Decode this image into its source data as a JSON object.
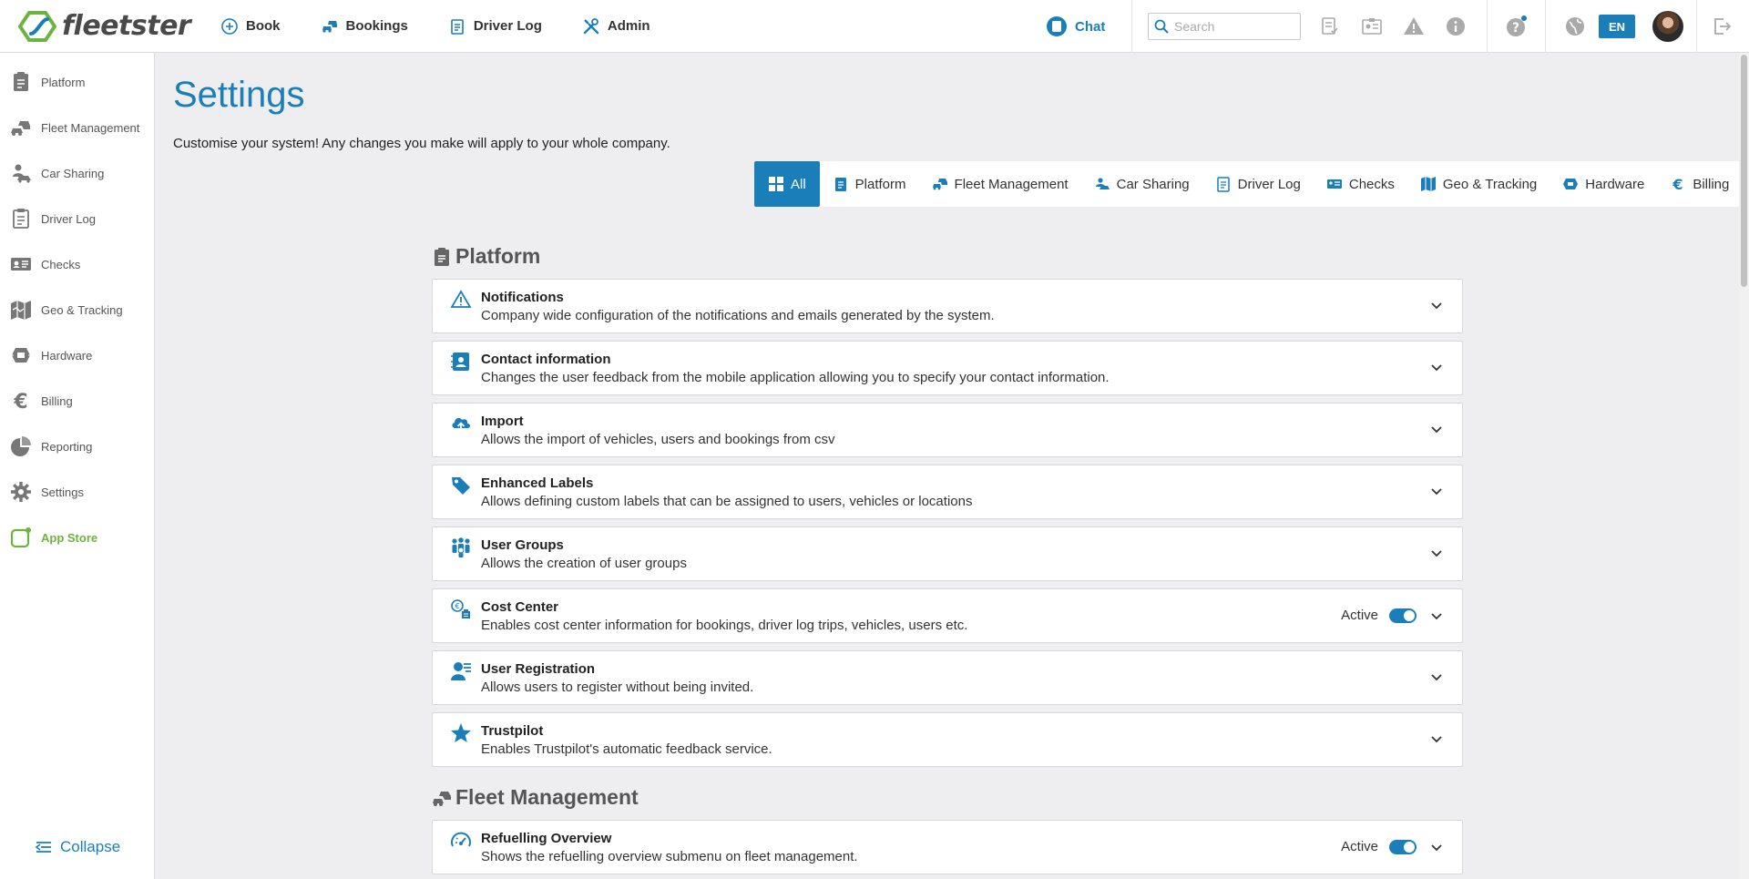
{
  "brand": {
    "name": "fleetster"
  },
  "topnav": [
    {
      "label": "Book",
      "icon": "plus-circle-icon"
    },
    {
      "label": "Bookings",
      "icon": "cars-icon"
    },
    {
      "label": "Driver Log",
      "icon": "clipboard-icon"
    },
    {
      "label": "Admin",
      "icon": "tools-icon"
    }
  ],
  "topbar": {
    "chat_label": "Chat",
    "search_placeholder": "Search",
    "lang": "EN"
  },
  "sidebar": {
    "items": [
      {
        "label": "Platform",
        "icon": "clipboard-icon"
      },
      {
        "label": "Fleet Management",
        "icon": "cars-icon"
      },
      {
        "label": "Car Sharing",
        "icon": "car-sharing-icon"
      },
      {
        "label": "Driver Log",
        "icon": "driver-log-icon"
      },
      {
        "label": "Checks",
        "icon": "id-card-icon"
      },
      {
        "label": "Geo & Tracking",
        "icon": "map-icon"
      },
      {
        "label": "Hardware",
        "icon": "hardware-icon"
      },
      {
        "label": "Billing",
        "icon": "euro-icon"
      },
      {
        "label": "Reporting",
        "icon": "pie-chart-icon"
      },
      {
        "label": "Settings",
        "icon": "gear-icon"
      },
      {
        "label": "App Store",
        "icon": "app-store-icon"
      }
    ],
    "collapse_label": "Collapse"
  },
  "page": {
    "title": "Settings",
    "description": "Customise your system! Any changes you make will apply to your whole company."
  },
  "filters": [
    {
      "label": "All",
      "active": true
    },
    {
      "label": "Platform"
    },
    {
      "label": "Fleet Management"
    },
    {
      "label": "Car Sharing"
    },
    {
      "label": "Driver Log"
    },
    {
      "label": "Checks"
    },
    {
      "label": "Geo & Tracking"
    },
    {
      "label": "Hardware"
    },
    {
      "label": "Billing"
    }
  ],
  "sections": {
    "platform": {
      "title": "Platform",
      "cards": [
        {
          "title": "Notifications",
          "desc": "Company wide configuration of the notifications and emails generated by the system.",
          "icon": "warning-icon"
        },
        {
          "title": "Contact information",
          "desc": "Changes the user feedback from the mobile application allowing you to specify your contact information.",
          "icon": "contact-book-icon"
        },
        {
          "title": "Import",
          "desc": "Allows the import of vehicles, users and bookings from csv",
          "icon": "cloud-upload-icon"
        },
        {
          "title": "Enhanced Labels",
          "desc": "Allows defining custom labels that can be assigned to users, vehicles or locations",
          "icon": "tag-icon"
        },
        {
          "title": "User Groups",
          "desc": "Allows the creation of user groups",
          "icon": "user-group-icon"
        },
        {
          "title": "Cost Center",
          "desc": "Enables cost center information for bookings, driver log trips, vehicles, users etc.",
          "icon": "cost-center-icon",
          "status": "Active"
        },
        {
          "title": "User Registration",
          "desc": "Allows users to register without being invited.",
          "icon": "user-registration-icon"
        },
        {
          "title": "Trustpilot",
          "desc": "Enables Trustpilot's automatic feedback service.",
          "icon": "star-icon"
        }
      ]
    },
    "fleet": {
      "title": "Fleet Management",
      "cards": [
        {
          "title": "Refuelling Overview",
          "desc": "Shows the refuelling overview submenu on fleet management.",
          "icon": "gauge-icon",
          "status": "Active"
        }
      ]
    }
  },
  "colors": {
    "primary": "#1a7fb8",
    "app_store": "#6db33f",
    "background": "#eeedf0"
  }
}
